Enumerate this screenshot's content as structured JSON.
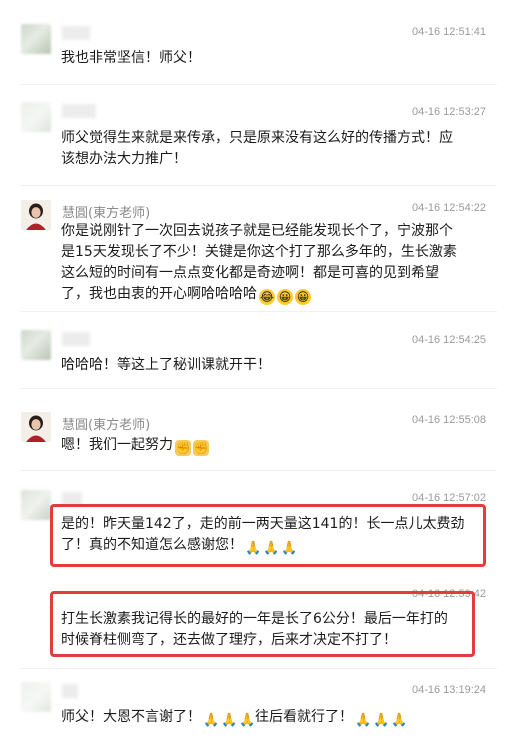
{
  "messages": [
    {
      "name": "",
      "time": "04-16 12:51:41",
      "text": "我也非常坚信！师父！"
    },
    {
      "name": "",
      "time": "04-16 12:53:27",
      "text": "师父觉得生来就是来传承，只是原来没有这么好的传播方式！应该想办法大力推广！"
    },
    {
      "name": "慧圓(東方老师)",
      "time": "04-16 12:54:22",
      "text": "你是说刚针了一次回去说孩子就是已经能发现长个了，宁波那个是15天发现长了不少！关键是你这个打了那么多年的，生长激素这么短的时间有一点点变化都是奇迹啊！都是可喜的见到希望了，我也由衷的开心啊哈哈哈哈"
    },
    {
      "name": "",
      "time": "04-16 12:54:25",
      "text": "哈哈哈！等这上了秘训课就开干！"
    },
    {
      "name": "慧圓(東方老师)",
      "time": "04-16 12:55:08",
      "text": "嗯！我们一起努力"
    },
    {
      "name": "",
      "time": "04-16 12:57:02",
      "text": "是的！昨天量142了，走的前一两天量这141的！长一点儿太费劲了！真的不知道怎么感谢您！"
    },
    {
      "name": "",
      "time": "04-16 12:59:42",
      "text": "打生长激素我记得长的最好的一年是长了6公分！最后一年打的时候脊柱侧弯了，还去做了理疗，后来才决定不打了！"
    },
    {
      "name": "",
      "time": "04-16 13:19:24",
      "text_a": "师父！大恩不言谢了！",
      "text_b": "往后看就行了！"
    }
  ],
  "icons": {
    "laugh": "face-with-tears-of-joy",
    "grin": "grinning-face",
    "fist": "raised-fist",
    "pray": "folded-hands"
  },
  "colors": {
    "highlight": "#e53b3b",
    "timestamp": "#9a9a9a",
    "name": "#8a8a8a"
  }
}
